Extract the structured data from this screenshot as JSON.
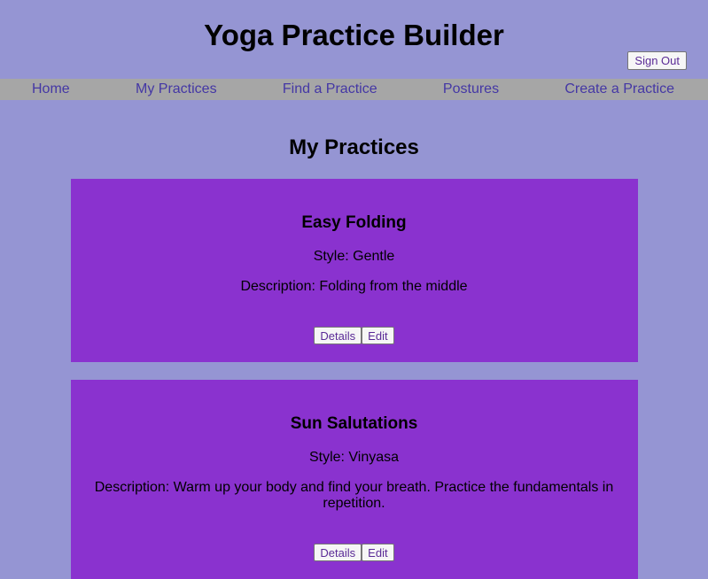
{
  "header": {
    "title": "Yoga Practice Builder",
    "sign_out_label": "Sign Out"
  },
  "nav": {
    "items": [
      {
        "label": "Home"
      },
      {
        "label": "My Practices"
      },
      {
        "label": "Find a Practice"
      },
      {
        "label": "Postures"
      },
      {
        "label": "Create a Practice"
      }
    ]
  },
  "main": {
    "heading": "My Practices",
    "practices": [
      {
        "name": "Easy Folding",
        "style": "Style: Gentle",
        "description": "Description: Folding from the middle",
        "details_label": "Details",
        "edit_label": "Edit"
      },
      {
        "name": "Sun Salutations",
        "style": "Style: Vinyasa",
        "description": "Description: Warm up your body and find your breath. Practice the fundamentals in repetition.",
        "details_label": "Details",
        "edit_label": "Edit"
      }
    ]
  },
  "colors": {
    "page_background": "#9595d3",
    "nav_background": "#a6a6a6",
    "nav_link": "#4437a5",
    "card_background": "#8a32cf"
  }
}
